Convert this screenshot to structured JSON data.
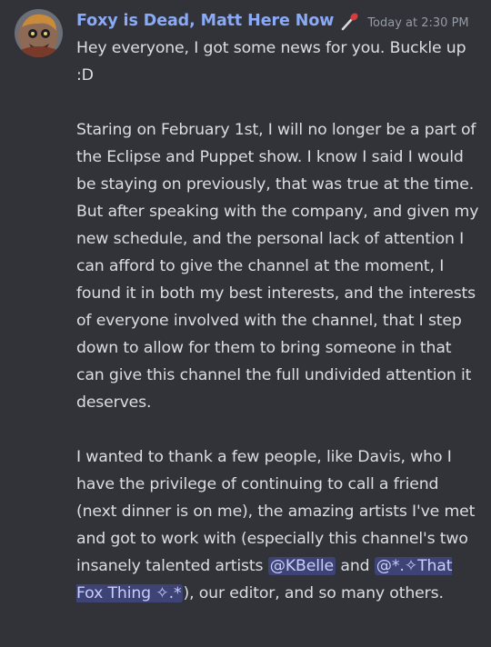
{
  "message": {
    "author": "Foxy is Dead, Matt Here Now",
    "role_icon": "red-microphone-icon",
    "timestamp": "Today at 2:30 PM",
    "paragraph1": "Hey everyone, I got some news for you. Buckle up :D",
    "paragraph2": "Staring on February 1st, I will no longer be a part of the Eclipse and Puppet show. I know I said I would be staying on previously, that was true at the time. But after speaking with the company, and given my new schedule, and the personal lack of attention I can afford to give the channel at the moment, I found it in both my best interests, and the interests of everyone involved with the channel, that I step down to allow for them to bring someone in that can give this channel the full undivided attention it deserves.",
    "paragraph3_part1": "I wanted to thank a few people, like Davis, who I have the privilege of continuing to call a friend (next dinner is on me), the amazing artists I've met and got to work with (especially this channel's two insanely talented artists ",
    "mention1": "@KBelle",
    "paragraph3_part2": " and ",
    "mention2": "@*.✧That Fox Thing ✧.*",
    "paragraph3_part3": "), our editor, and so many others."
  },
  "colors": {
    "background": "#313338",
    "username": "#8aa9f7",
    "text": "#dbdee1",
    "timestamp": "#949ba4",
    "mention_bg": "#3e4375",
    "mention_text": "#c9cdfb"
  }
}
